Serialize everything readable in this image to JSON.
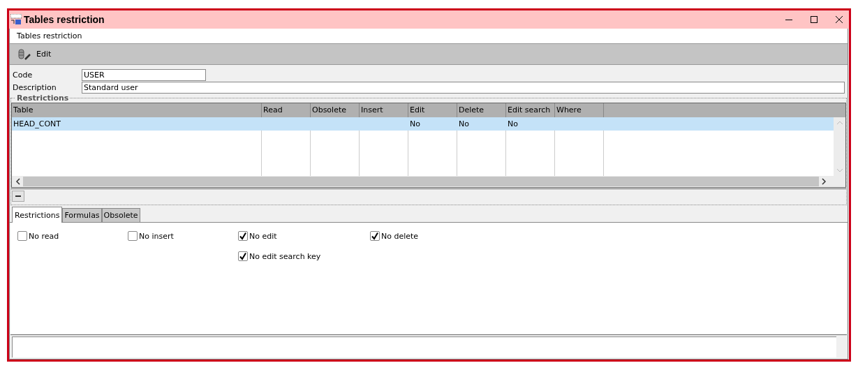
{
  "window": {
    "title": "Tables restriction"
  },
  "header": {
    "title": "Tables restriction"
  },
  "toolbar": [
    {
      "label": "Edit"
    }
  ],
  "fields": [
    {
      "label": "Code",
      "value": "USER",
      "kind": "short"
    },
    {
      "label": "Description",
      "value": "Standard user",
      "kind": "wide"
    }
  ],
  "restrictions": {
    "title": "Restrictions",
    "columns": [
      "Table",
      "Read",
      "Obsolete",
      "Insert",
      "Edit",
      "Delete",
      "Edit search",
      "Where"
    ],
    "rows": [
      {
        "cells": [
          "HEAD_CONT",
          "",
          "",
          "",
          "No",
          "No",
          "No",
          ""
        ],
        "selected": true
      }
    ]
  },
  "tabs": [
    {
      "label": "Restrictions",
      "selected": true
    },
    {
      "label": "Formulas",
      "selected": false
    },
    {
      "label": "Obsolete",
      "selected": false
    }
  ],
  "checks": [
    {
      "label": "No read",
      "checked": false
    },
    {
      "label": "No insert",
      "checked": false
    },
    {
      "label": "No edit",
      "checked": true
    },
    {
      "label": "No delete",
      "checked": true
    },
    {
      "label": "No edit search key",
      "checked": true
    }
  ]
}
